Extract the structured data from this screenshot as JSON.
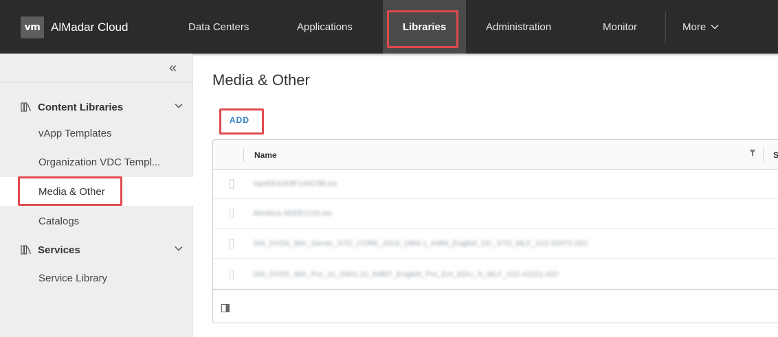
{
  "header": {
    "logo_text": "vm",
    "brand": "AlMadar Cloud",
    "nav": [
      {
        "label": "Data Centers"
      },
      {
        "label": "Applications"
      },
      {
        "label": "Libraries",
        "active": true
      },
      {
        "label": "Administration"
      },
      {
        "label": "Monitor"
      },
      {
        "label": "More"
      }
    ]
  },
  "sidebar": {
    "collapse_glyph": "«",
    "groups": [
      {
        "label": "Content Libraries",
        "icon": "library-icon",
        "items": [
          {
            "label": "vApp Templates"
          },
          {
            "label": "Organization VDC Templ..."
          },
          {
            "label": "Media & Other",
            "selected": true
          },
          {
            "label": "Catalogs"
          }
        ]
      },
      {
        "label": "Services",
        "icon": "library-icon",
        "items": [
          {
            "label": "Service Library"
          }
        ]
      }
    ]
  },
  "main": {
    "title": "Media & Other",
    "add_label": "ADD",
    "grid": {
      "columns": [
        {
          "label": "Name"
        },
        {
          "label": "S"
        }
      ],
      "rows": [
        {
          "name": "VanEE41E8F149C5B.iso"
        },
        {
          "name": "AlmAlza-SEEE1216.iso"
        },
        {
          "name": "SW_DVD9_Win_Server_STD_CORE_2019_1809.1_64Bit_English_DC_STD_MLF_X22-02970.ISO"
        },
        {
          "name": "SW_DVD5_Win_Pro_10_20H2.10_64BIT_English_Pro_Ent_EDU_N_MLF_X22-41521.ISO"
        }
      ]
    }
  },
  "colors": {
    "topbar": "#2b2b2b",
    "highlight": "#e04a4f",
    "link": "#2b7bbf",
    "sidebar": "#eeeeee"
  }
}
